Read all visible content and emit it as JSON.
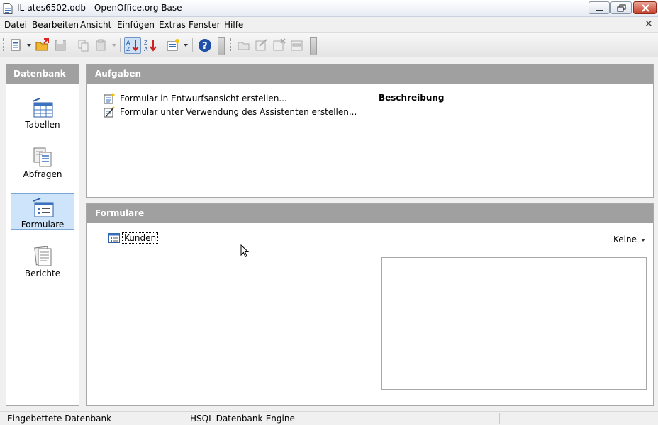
{
  "window": {
    "title": "IL-ates6502.odb - OpenOffice.org Base"
  },
  "menubar": {
    "items": [
      "Datei",
      "Bearbeiten",
      "Ansicht",
      "Einfügen",
      "Extras",
      "Fenster",
      "Hilfe"
    ],
    "close_glyph": "✕"
  },
  "toolbar": {
    "icons": [
      "new-document-icon",
      "open-folder-icon",
      "save-icon",
      "copy-icon",
      "paste-icon",
      "sort-ascending-icon",
      "sort-descending-icon",
      "form-wizard-icon",
      "help-icon",
      "open-db-object-icon",
      "edit-icon",
      "delete-icon",
      "rename-icon"
    ]
  },
  "left_panel": {
    "header": "Datenbank",
    "items": [
      {
        "label": "Tabellen",
        "selected": false
      },
      {
        "label": "Abfragen",
        "selected": false
      },
      {
        "label": "Formulare",
        "selected": true
      },
      {
        "label": "Berichte",
        "selected": false
      }
    ]
  },
  "tasks": {
    "header": "Aufgaben",
    "items": [
      "Formular in Entwurfsansicht erstellen...",
      "Formular unter Verwendung des Assistenten erstellen..."
    ],
    "description_title": "Beschreibung"
  },
  "forms": {
    "header": "Formulare",
    "items": [
      "Kunden"
    ],
    "preview_mode": "Keine"
  },
  "statusbar": {
    "embedded": "Eingebettete Datenbank",
    "engine": "HSQL Datenbank-Engine"
  },
  "colors": {
    "panel_header": "#a0a0a0",
    "selection": "#cde4fb",
    "close_button": "#c7402a"
  }
}
